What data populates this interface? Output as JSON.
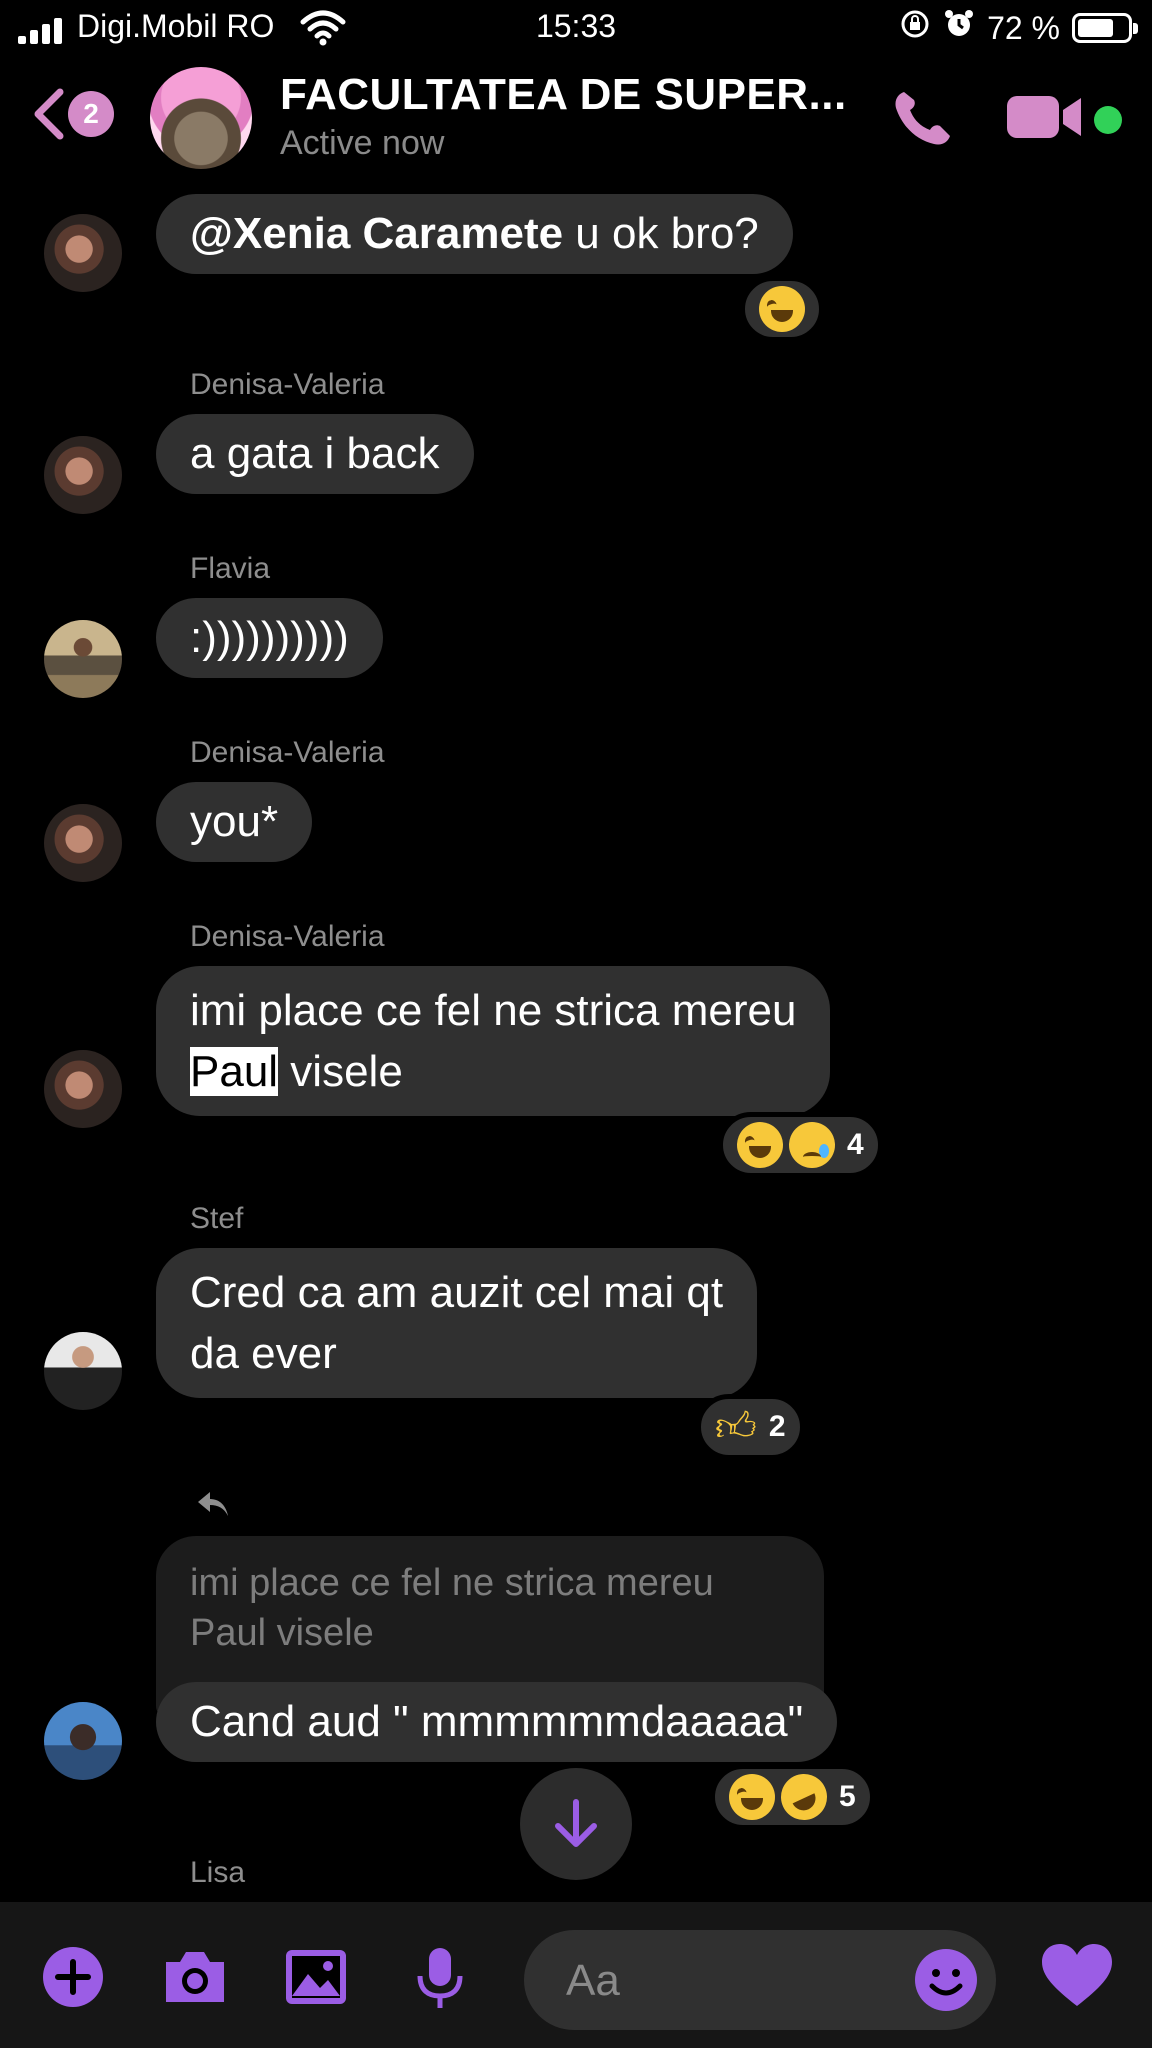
{
  "status_bar": {
    "carrier": "Digi.Mobil RO",
    "time": "15:33",
    "battery": "72 %",
    "battery_level": 0.72
  },
  "header": {
    "back_badge": "2",
    "title": "FACULTATEA DE SUPER...",
    "subtitle": "Active now",
    "accent_color": "#d48bc8"
  },
  "messages": [
    {
      "sender": "",
      "text_mention": "@Xenia Caramete",
      "text": " u ok bro?",
      "reactions": [
        "laughing"
      ]
    },
    {
      "sender": "Denisa-Valeria",
      "text": "a gata i back"
    },
    {
      "sender": "Flavia",
      "text": ":))))))))))"
    },
    {
      "sender": "Denisa-Valeria",
      "text": "you*"
    },
    {
      "sender": "Denisa-Valeria",
      "line1": "imi place ce fel ne strica mereu",
      "line2_highlight": "Paul",
      "line2_rest": " visele",
      "reactions": [
        "laughing",
        "crying"
      ],
      "reaction_count": "4"
    },
    {
      "sender": "Stef",
      "line1": "Cred ca am auzit cel mai qt",
      "line2": "da ever",
      "reactions": [
        "thumbs-up"
      ],
      "reaction_count": "2"
    },
    {
      "sender": "",
      "reply_quote_line1": "imi place ce fel ne strica mereu",
      "reply_quote_line2": "Paul visele",
      "text": "Cand aud \" mmmmmmdaaaaa\"",
      "reactions": [
        "laughing",
        "rofl"
      ],
      "reaction_count": "5"
    },
    {
      "sender": "Lisa"
    }
  ],
  "composer": {
    "placeholder": "Aa",
    "accent_color": "#9b5de5"
  }
}
